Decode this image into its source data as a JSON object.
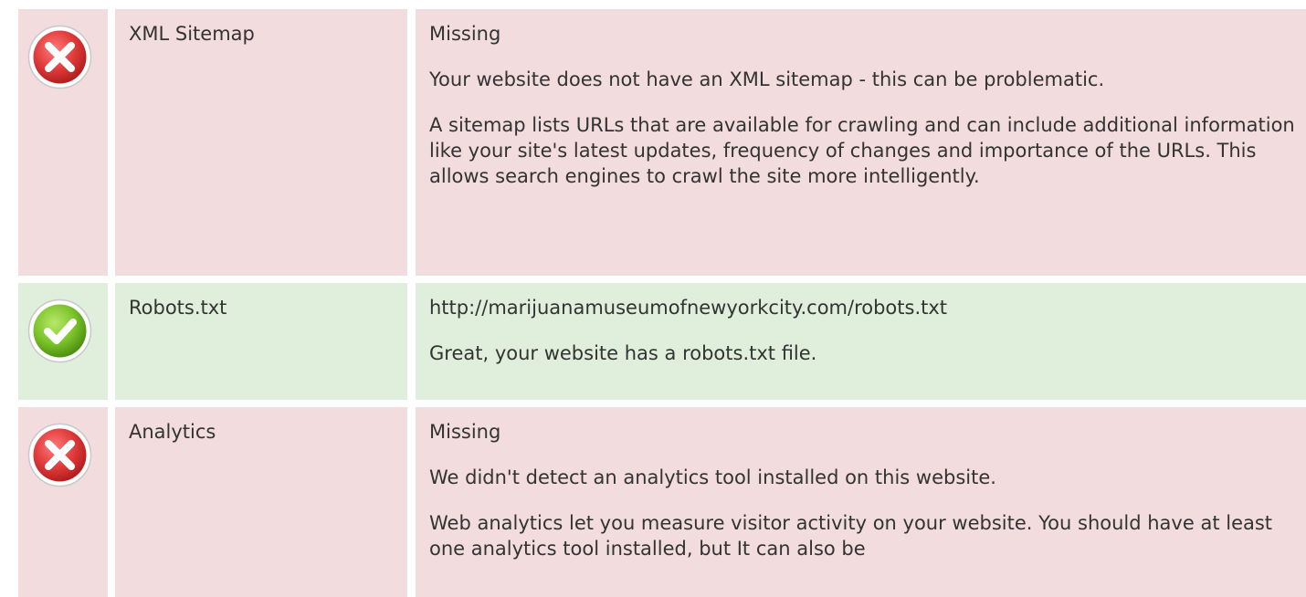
{
  "checks": [
    {
      "status": "fail",
      "icon": "error-x-icon",
      "name": "XML Sitemap",
      "value": "Missing",
      "paragraphs": [
        "Your website does not have an XML sitemap - this can be problematic.",
        "A sitemap lists URLs that are available for crawling and can include additional information like your site's latest updates, frequency of changes and importance of the URLs. This allows search engines to crawl the site more intelligently."
      ]
    },
    {
      "status": "pass",
      "icon": "success-check-icon",
      "name": "Robots.txt",
      "value": "http://marijuanamuseumofnewyorkcity.com/robots.txt",
      "paragraphs": [
        "Great, your website has a robots.txt file."
      ]
    },
    {
      "status": "fail",
      "icon": "error-x-icon",
      "name": "Analytics",
      "value": "Missing",
      "paragraphs": [
        "We didn't detect an analytics tool installed on this website.",
        "Web analytics let you measure visitor activity on your website. You should have at least one analytics tool installed, but It can also be"
      ]
    }
  ],
  "colors": {
    "fail_background": "#f2dcdd",
    "pass_background": "#e0efdc",
    "fail_icon": "#e03a3a",
    "pass_icon": "#7cc32a",
    "text": "#333333"
  }
}
